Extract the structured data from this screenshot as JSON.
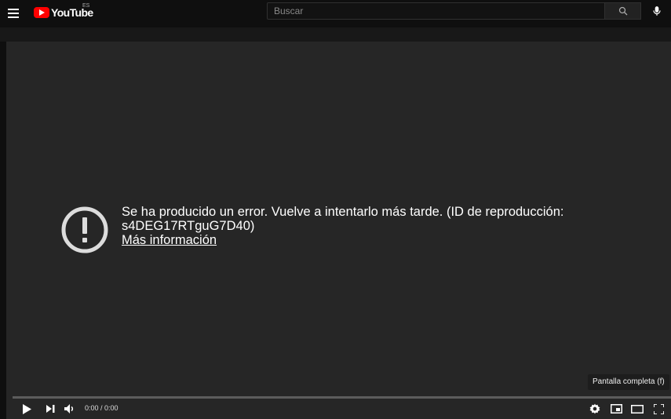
{
  "header": {
    "menu_icon": "hamburger-menu-icon",
    "logo_text": "YouTube",
    "country_code": "ES",
    "search_placeholder": "Buscar",
    "search_icon": "search-icon",
    "mic_icon": "microphone-icon"
  },
  "player": {
    "error_message": "Se ha producido un error. Vuelve a intentarlo más tarde. (ID de reproducción: s4DEG17RTguG7D40)",
    "error_link": "Más información",
    "error_icon": "error-exclamation-icon",
    "tooltip": "Pantalla completa (f)",
    "progress_fraction": 0,
    "time_display": "0:00 / 0:00",
    "controls": {
      "play_icon": "play-icon",
      "next_icon": "next-icon",
      "volume_icon": "volume-icon",
      "settings_icon": "gear-icon",
      "miniplayer_icon": "miniplayer-icon",
      "theater_icon": "theater-mode-icon",
      "fullscreen_icon": "fullscreen-icon"
    }
  },
  "colors": {
    "background": "#0f0f0f",
    "player_background": "#262626",
    "brand_red": "#ff0000"
  }
}
